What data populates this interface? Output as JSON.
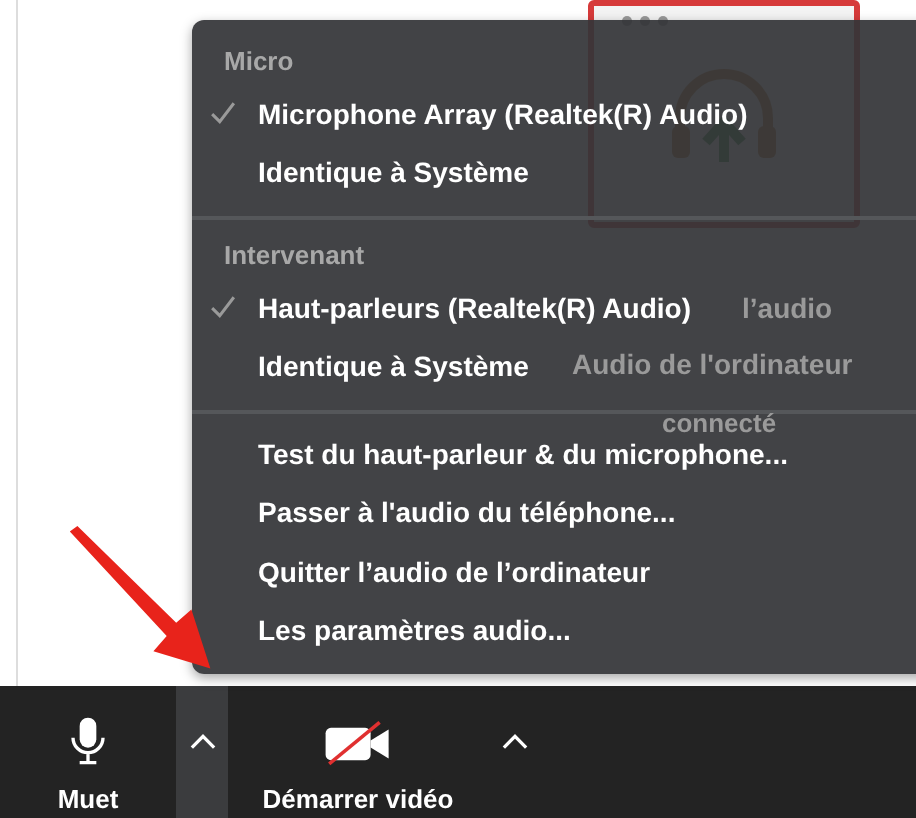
{
  "audio_card": {
    "title": "l’audio",
    "subtitle": "Audio de l'ordinateur",
    "status": "connecté"
  },
  "menu": {
    "sections": [
      {
        "header": "Micro",
        "items": [
          {
            "label": "Microphone Array (Realtek(R) Audio)",
            "checked": true
          },
          {
            "label": "Identique à Système",
            "checked": false
          }
        ]
      },
      {
        "header": "Intervenant",
        "items": [
          {
            "label": "Haut-parleurs (Realtek(R) Audio)",
            "checked": true
          },
          {
            "label": "Identique à Système",
            "checked": false
          }
        ]
      },
      {
        "items": [
          {
            "label": "Test du haut-parleur & du microphone..."
          },
          {
            "label": "Passer à l'audio du téléphone..."
          },
          {
            "label": "Quitter l’audio de l’ordinateur"
          },
          {
            "label": "Les paramètres audio..."
          }
        ]
      }
    ]
  },
  "toolbar": [
    {
      "kind": "mic",
      "label": "Muet"
    },
    {
      "kind": "caret",
      "selected": true
    },
    {
      "kind": "video",
      "label": "Démarrer vidéo"
    },
    {
      "kind": "caret",
      "selected": false
    }
  ]
}
